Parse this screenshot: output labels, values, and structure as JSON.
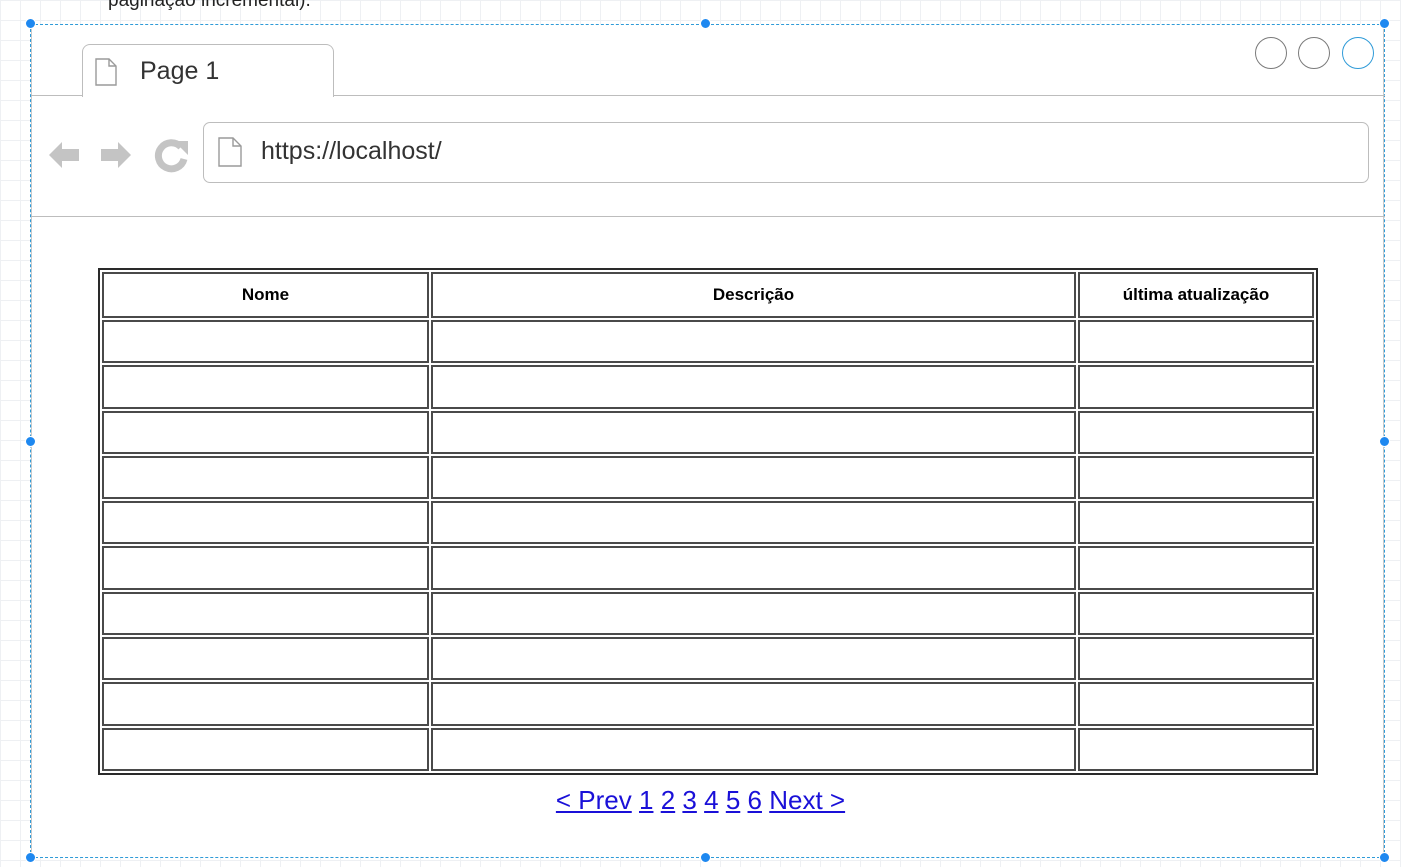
{
  "annotation": {
    "cutoff_text": "paginação incremental)."
  },
  "browser": {
    "tab": {
      "title": "Page 1",
      "icon": "page-icon"
    },
    "window_controls": [
      "circle",
      "circle",
      "circle-active"
    ],
    "nav": {
      "back_icon": "arrow-left-icon",
      "forward_icon": "arrow-right-icon",
      "reload_icon": "reload-icon"
    },
    "address_bar": {
      "icon": "page-icon",
      "url": "https://localhost/"
    }
  },
  "table": {
    "columns": [
      "Nome",
      "Descrição",
      "última atualização"
    ],
    "rows": [
      [
        "",
        "",
        ""
      ],
      [
        "",
        "",
        ""
      ],
      [
        "",
        "",
        ""
      ],
      [
        "",
        "",
        ""
      ],
      [
        "",
        "",
        ""
      ],
      [
        "",
        "",
        ""
      ],
      [
        "",
        "",
        ""
      ],
      [
        "",
        "",
        ""
      ],
      [
        "",
        "",
        ""
      ],
      [
        "",
        "",
        ""
      ]
    ]
  },
  "pagination": {
    "prev": "< Prev",
    "pages": [
      "1",
      "2",
      "3",
      "4",
      "5",
      "6"
    ],
    "next": "Next >"
  },
  "colors": {
    "selection_handle": "#1e88f0",
    "selection_border": "#2f9bd8",
    "link": "#1a10d8",
    "nav_icon": "#c4c4c4"
  }
}
